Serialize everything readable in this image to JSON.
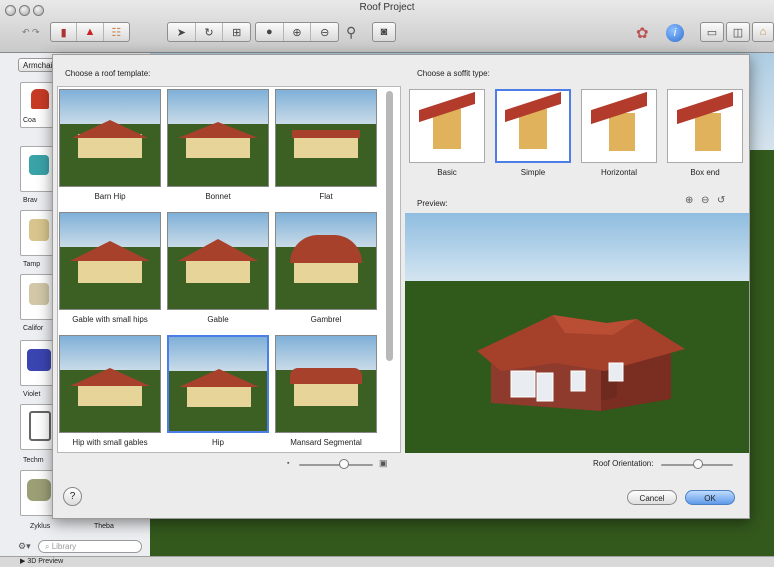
{
  "window": {
    "title": "Roof Project"
  },
  "sidebar": {
    "category": "Armchairs",
    "items": [
      {
        "label": "Coa"
      },
      {
        "label": "Brav"
      },
      {
        "label": "Tamp"
      },
      {
        "label": "Califor"
      },
      {
        "label": "Violet"
      },
      {
        "label": "Techm"
      }
    ],
    "extra_item_label": "Zyklus",
    "extra_item_label2": "Theba",
    "search_placeholder": "Library",
    "footer_label": "3D Preview"
  },
  "dialog": {
    "template_heading": "Choose a roof template:",
    "soffit_heading": "Choose a soffit type:",
    "preview_label": "Preview:",
    "roof_templates": [
      {
        "label": "Barn Hip"
      },
      {
        "label": "Bonnet"
      },
      {
        "label": "Flat"
      },
      {
        "label": "Gable with small hips"
      },
      {
        "label": "Gable"
      },
      {
        "label": "Gambrel"
      },
      {
        "label": "Hip with small gables"
      },
      {
        "label": "Hip"
      },
      {
        "label": "Mansard Segmental"
      }
    ],
    "selected_template": "Hip",
    "soffits": [
      {
        "label": "Basic"
      },
      {
        "label": "Simple"
      },
      {
        "label": "Horizontal"
      },
      {
        "label": "Box end"
      }
    ],
    "selected_soffit": "Simple",
    "orientation_label": "Roof Orientation:",
    "orientation_value": 0.5,
    "thumb_size_value": 0.55,
    "cancel_label": "Cancel",
    "ok_label": "OK",
    "help_label": "?"
  },
  "colors": {
    "accent": "#4d7ee8",
    "grass": "#33591d",
    "roof": "#a8412c",
    "wall": "#e6d29a"
  }
}
